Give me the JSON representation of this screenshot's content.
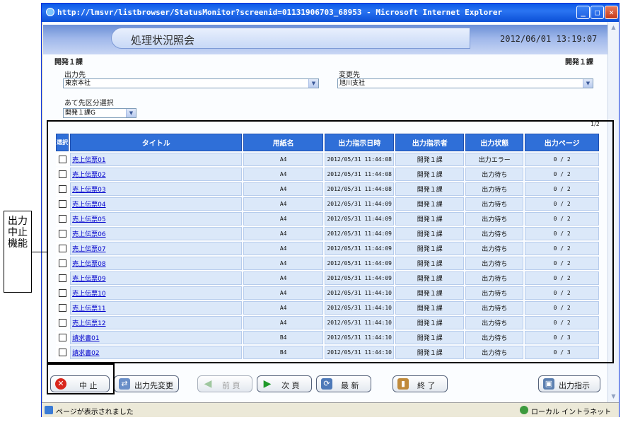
{
  "window": {
    "title": "http://lmsvr/listbrowser/StatusMonitor?screenid=01131906703_68953 - Microsoft Internet Explorer",
    "minimize_label": "_",
    "maximize_label": "□",
    "close_label": "✕"
  },
  "header": {
    "title": "処理状況照会",
    "datetime": "2012/06/01 13:19:07"
  },
  "form": {
    "dept_left": "開発１課",
    "dept_right": "開発１課",
    "output_dest_label": "出力先",
    "output_dest_value": "東京本社",
    "change_dest_label": "変更先",
    "change_dest_value": "旭川支社",
    "dest_category_label": "あて先区分選択",
    "dest_category_value": "開発１課G",
    "page_indicator": "1/2"
  },
  "table": {
    "headers": {
      "select": "選択",
      "title": "タイトル",
      "paper": "用紙名",
      "datetime": "出力指示日時",
      "instructor": "出力指示者",
      "status": "出力状態",
      "pages": "出力ページ"
    },
    "rows": [
      {
        "title": "売上伝票01",
        "paper": "A4",
        "datetime": "2012/05/31 11:44:08",
        "instructor": "開発１課",
        "status": "出力エラー",
        "pages": "0 / 2"
      },
      {
        "title": "売上伝票02",
        "paper": "A4",
        "datetime": "2012/05/31 11:44:08",
        "instructor": "開発１課",
        "status": "出力待ち",
        "pages": "0 / 2"
      },
      {
        "title": "売上伝票03",
        "paper": "A4",
        "datetime": "2012/05/31 11:44:08",
        "instructor": "開発１課",
        "status": "出力待ち",
        "pages": "0 / 2"
      },
      {
        "title": "売上伝票04",
        "paper": "A4",
        "datetime": "2012/05/31 11:44:09",
        "instructor": "開発１課",
        "status": "出力待ち",
        "pages": "0 / 2"
      },
      {
        "title": "売上伝票05",
        "paper": "A4",
        "datetime": "2012/05/31 11:44:09",
        "instructor": "開発１課",
        "status": "出力待ち",
        "pages": "0 / 2"
      },
      {
        "title": "売上伝票06",
        "paper": "A4",
        "datetime": "2012/05/31 11:44:09",
        "instructor": "開発１課",
        "status": "出力待ち",
        "pages": "0 / 2"
      },
      {
        "title": "売上伝票07",
        "paper": "A4",
        "datetime": "2012/05/31 11:44:09",
        "instructor": "開発１課",
        "status": "出力待ち",
        "pages": "0 / 2"
      },
      {
        "title": "売上伝票08",
        "paper": "A4",
        "datetime": "2012/05/31 11:44:09",
        "instructor": "開発１課",
        "status": "出力待ち",
        "pages": "0 / 2"
      },
      {
        "title": "売上伝票09",
        "paper": "A4",
        "datetime": "2012/05/31 11:44:09",
        "instructor": "開発１課",
        "status": "出力待ち",
        "pages": "0 / 2"
      },
      {
        "title": "売上伝票10",
        "paper": "A4",
        "datetime": "2012/05/31 11:44:10",
        "instructor": "開発１課",
        "status": "出力待ち",
        "pages": "0 / 2"
      },
      {
        "title": "売上伝票11",
        "paper": "A4",
        "datetime": "2012/05/31 11:44:10",
        "instructor": "開発１課",
        "status": "出力待ち",
        "pages": "0 / 2"
      },
      {
        "title": "売上伝票12",
        "paper": "A4",
        "datetime": "2012/05/31 11:44:10",
        "instructor": "開発１課",
        "status": "出力待ち",
        "pages": "0 / 2"
      },
      {
        "title": "請求書01",
        "paper": "B4",
        "datetime": "2012/05/31 11:44:10",
        "instructor": "開発１課",
        "status": "出力待ち",
        "pages": "0 / 3"
      },
      {
        "title": "請求書02",
        "paper": "B4",
        "datetime": "2012/05/31 11:44:10",
        "instructor": "開発１課",
        "status": "出力待ち",
        "pages": "0 / 3"
      }
    ]
  },
  "buttons": {
    "stop": "中 止",
    "change_dest": "出力先変更",
    "prev": "前 頁",
    "next": "次 頁",
    "refresh": "最 新",
    "exit": "終 了",
    "output": "出力指示"
  },
  "statusbar": {
    "message": "ページが表示されました",
    "zone": "ローカル イントラネット"
  },
  "callout": {
    "text": "出力中止機能"
  },
  "colors": {
    "titlebar": "#0a58e8",
    "header_cell": "#2f6fd8",
    "row_cell": "#dbe8f9",
    "stop_icon": "#d9261c",
    "next_arrow": "#1f9a2a",
    "prev_arrow": "#9fc79f"
  },
  "icons": {
    "stop": "x-circle-icon",
    "change_dest": "people-swap-icon",
    "prev": "arrow-left-icon",
    "next": "arrow-right-icon",
    "refresh": "monitor-refresh-icon",
    "exit": "door-exit-icon",
    "output": "monitor-print-icon"
  }
}
